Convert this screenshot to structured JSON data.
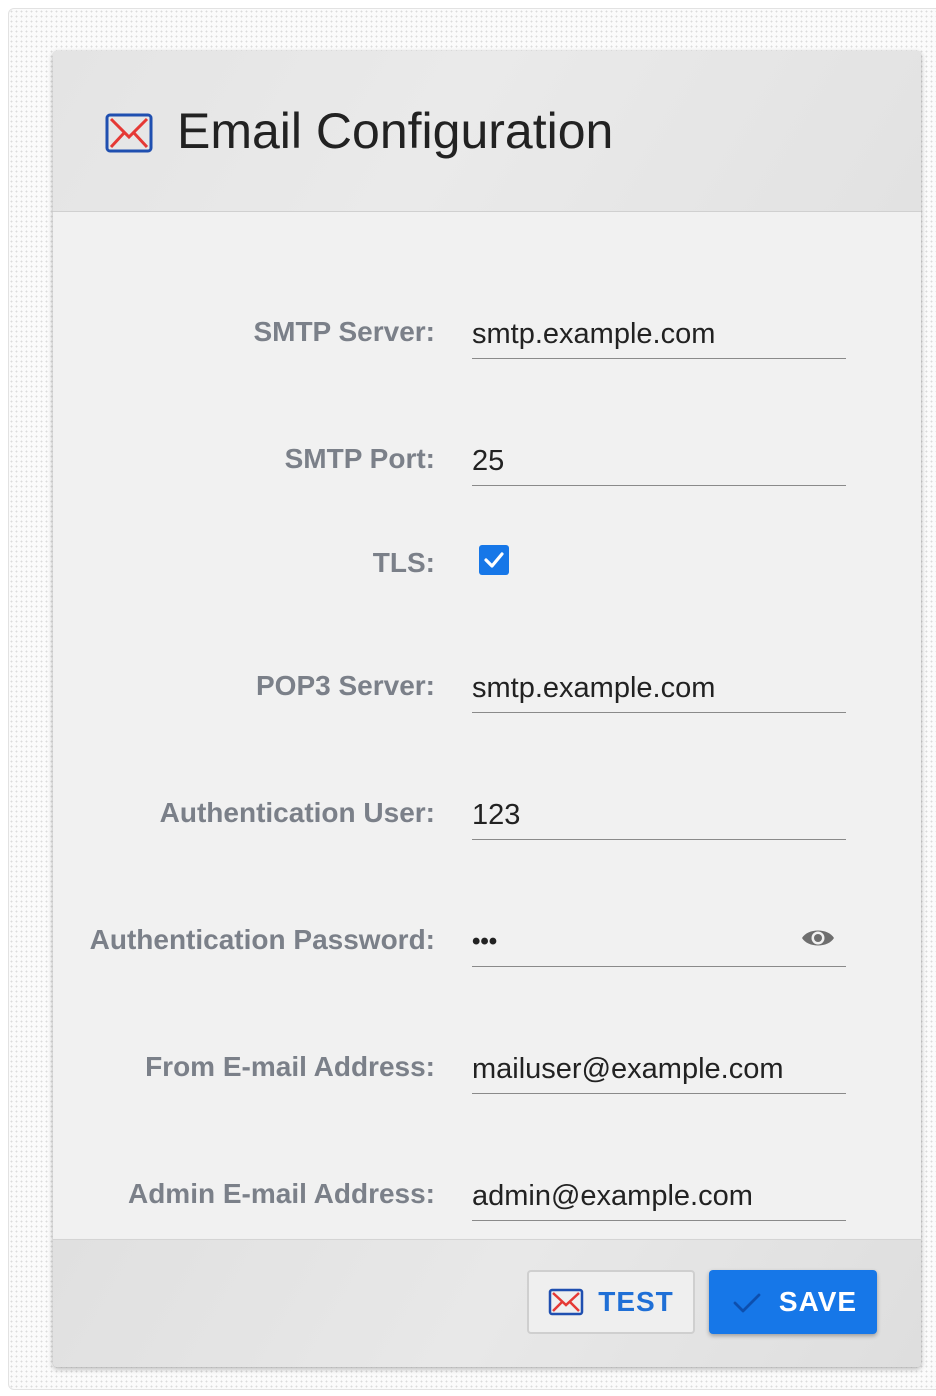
{
  "header": {
    "title": "Email Configuration",
    "icon": "envelope-icon"
  },
  "form": {
    "smtp_server": {
      "label": "SMTP Server:",
      "value": "smtp.example.com"
    },
    "smtp_port": {
      "label": "SMTP Port:",
      "value": "25"
    },
    "tls": {
      "label": "TLS:",
      "checked": true
    },
    "pop3_server": {
      "label": "POP3 Server:",
      "value": "smtp.example.com"
    },
    "auth_user": {
      "label": "Authentication User:",
      "value": "123"
    },
    "auth_password": {
      "label": "Authentication Password:",
      "value": "•••",
      "toggle_icon": "eye-icon"
    },
    "from_email": {
      "label": "From E-mail Address:",
      "value": "mailuser@example.com"
    },
    "admin_email": {
      "label": "Admin E-mail Address:",
      "value": "admin@example.com"
    }
  },
  "footer": {
    "test_label": "TEST",
    "save_label": "SAVE"
  },
  "colors": {
    "accent": "#1677e8",
    "icon_red": "#e53935",
    "label_gray": "#7b8089"
  }
}
